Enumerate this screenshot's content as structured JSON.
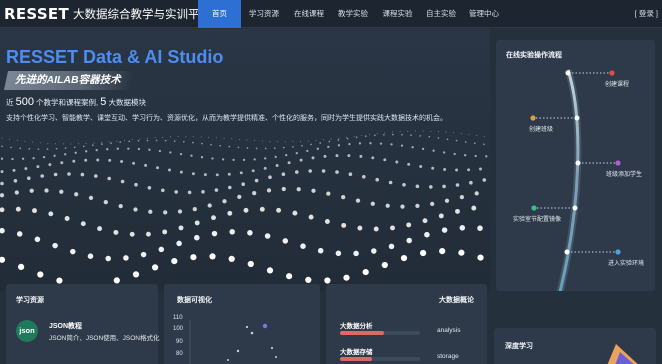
{
  "header": {
    "logo": "RESSET",
    "platform_name": "大数据综合教学与实训平台",
    "nav": [
      {
        "label": "首页",
        "active": true
      },
      {
        "label": "学习资源",
        "active": false
      },
      {
        "label": "在线课程",
        "active": false
      },
      {
        "label": "教学实验",
        "active": false
      },
      {
        "label": "课程实验",
        "active": false
      },
      {
        "label": "自主实验",
        "active": false
      },
      {
        "label": "管理中心",
        "active": false
      }
    ],
    "login": "[ 登录 ]"
  },
  "hero": {
    "title": "RESSET Data & AI Studio",
    "tagline": "先进的AILAB容器技术",
    "stats": {
      "prefix": "近",
      "cases_count": "500",
      "cases_text": "个教学和课程案例,",
      "modules_count": "5",
      "modules_text": "大数据模块"
    },
    "description": "支持个性化学习、智能教学、课堂互动、学习行为、资源优化，从而为教学提供精准、个性化的服务，同时为学生提供实践大数据技术的机会。"
  },
  "process": {
    "title": "在线实验操作流程",
    "steps": [
      {
        "label": "创建课程",
        "color": "#e04b4b"
      },
      {
        "label": "创建班级",
        "color": "#e0a040"
      },
      {
        "label": "班级添加学生",
        "color": "#b45bd6"
      },
      {
        "label": "实验室节配置镜像",
        "color": "#33c28a"
      },
      {
        "label": "进入实验环境",
        "color": "#4aa3df"
      }
    ]
  },
  "cards": {
    "resources": {
      "title": "学习资源",
      "badge": "json",
      "item_title": "JSON教程",
      "item_desc": "JSON简介、JSON使用、JSON格式化"
    },
    "viz": {
      "title": "数据可视化",
      "y_ticks": [
        "110",
        "100",
        "90",
        "80"
      ]
    },
    "bigdata": {
      "title": "大数据概论",
      "items": [
        {
          "label": "大数据分析",
          "tag": "analysis",
          "level": 0.55
        },
        {
          "label": "大数据存储",
          "tag": "storage",
          "level": 0.4
        }
      ]
    },
    "deep": {
      "title": "深度学习"
    }
  },
  "colors": {
    "accent": "#2d6fd2",
    "title_blue": "#4d8df0",
    "bg": "#25303d",
    "panel": "#2e3a49"
  }
}
